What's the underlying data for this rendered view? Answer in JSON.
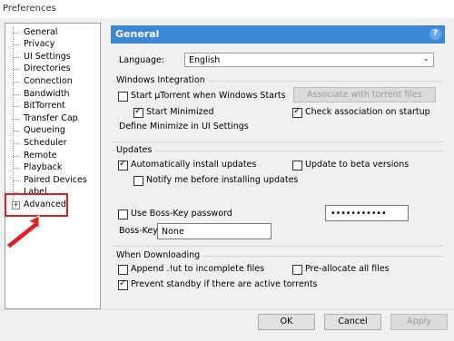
{
  "window": {
    "title": "Preferences"
  },
  "tree": {
    "items": [
      "General",
      "Privacy",
      "UI Settings",
      "Directories",
      "Connection",
      "Bandwidth",
      "BitTorrent",
      "Transfer Cap",
      "Queueing",
      "Scheduler",
      "Remote",
      "Playback",
      "Paired Devices",
      "Label",
      "Advanced"
    ],
    "expand_glyph": "+"
  },
  "panel": {
    "title": "General",
    "help_glyph": "?",
    "language_label": "Language:",
    "language_value": "English",
    "windows_integration": {
      "title": "Windows Integration",
      "start_with_windows": "Start µTorrent when Windows Starts",
      "start_minimized": "Start Minimized",
      "define_minimize": "Define Minimize in UI Settings",
      "associate_button": "Associate with torrent files",
      "check_association": "Check association on startup"
    },
    "updates": {
      "title": "Updates",
      "auto_install": "Automatically install updates",
      "beta": "Update to beta versions",
      "notify": "Notify me before installing updates",
      "boss_key_password": "Use Boss-Key password",
      "boss_key_label": "Boss-Key:",
      "boss_key_value": "None",
      "password_mask": "•••••••••••"
    },
    "when_downloading": {
      "title": "When Downloading",
      "append": "Append .!ut to incomplete files",
      "preallocate": "Pre-allocate all files",
      "prevent_standby": "Prevent standby if there are active torrents"
    }
  },
  "buttons": {
    "ok": "OK",
    "cancel": "Cancel",
    "apply": "Apply"
  },
  "colors": {
    "accent": "#3c86d6",
    "highlight": "#e02020"
  }
}
